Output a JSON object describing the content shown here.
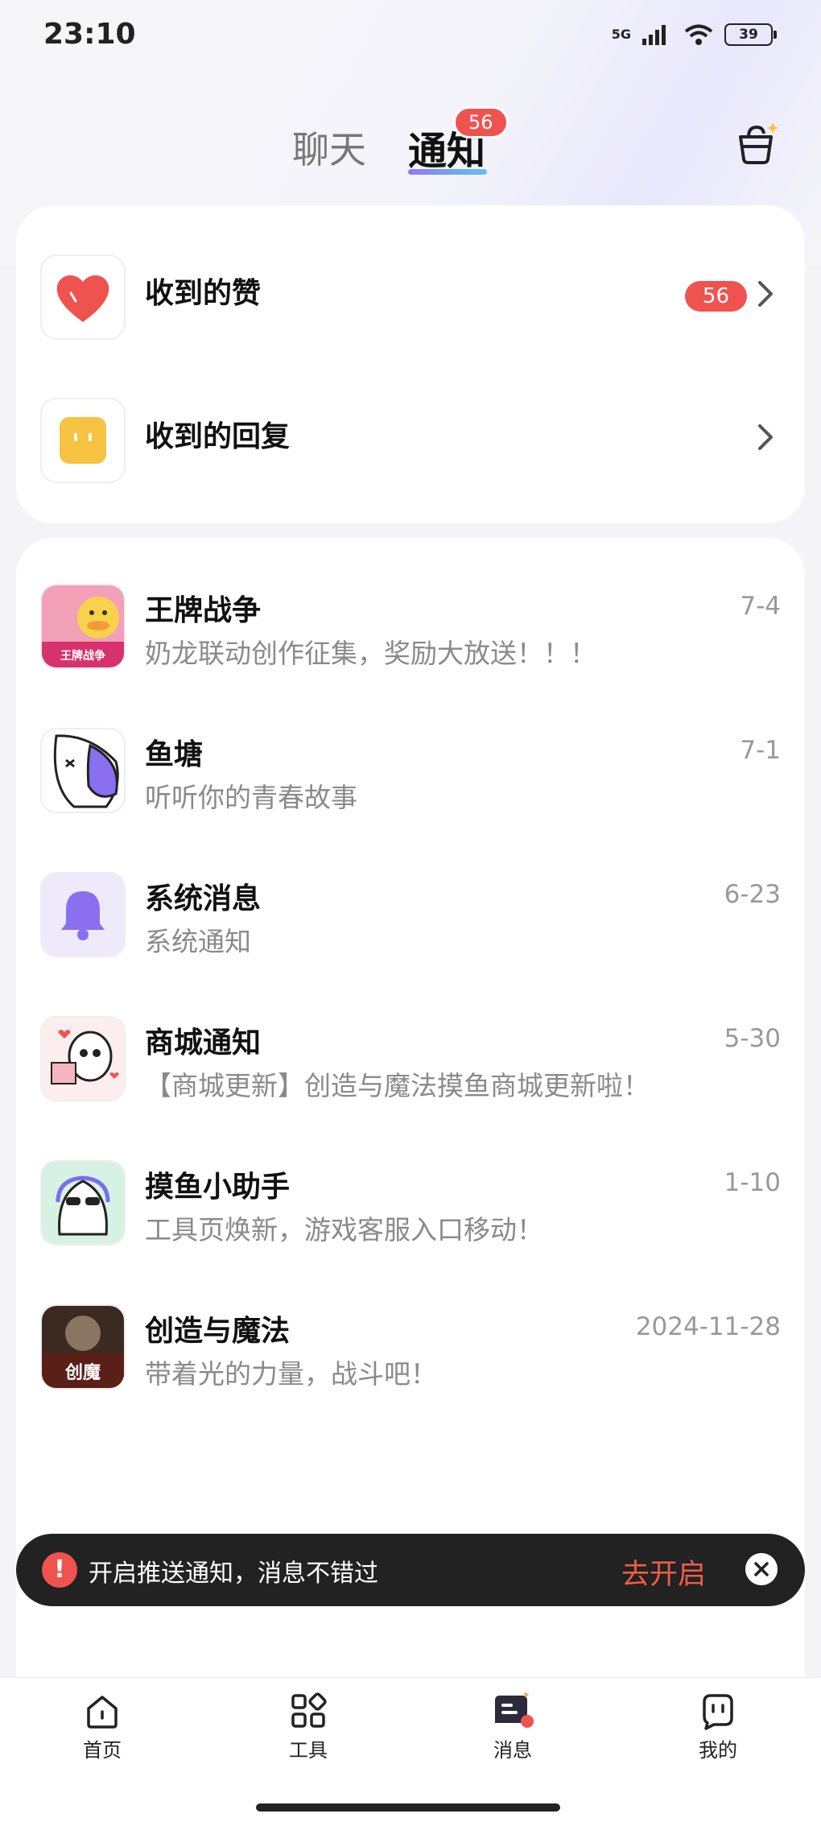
{
  "status_bar": {
    "time": "23:10",
    "network": "5G",
    "battery": "39"
  },
  "tabs": {
    "chat": "聊天",
    "notice": "通知",
    "notice_badge": "56"
  },
  "interactions": [
    {
      "label": "收到的赞",
      "badge": "56"
    },
    {
      "label": "收到的回复",
      "badge": ""
    }
  ],
  "notifications": [
    {
      "title": "王牌战争",
      "subtitle": "奶龙联动创作征集，奖励大放送！！！",
      "date": "7-4"
    },
    {
      "title": "鱼塘",
      "subtitle": "听听你的青春故事",
      "date": "7-1"
    },
    {
      "title": "系统消息",
      "subtitle": "系统通知",
      "date": "6-23"
    },
    {
      "title": "商城通知",
      "subtitle": "【商城更新】创造与魔法摸鱼商城更新啦！",
      "date": "5-30"
    },
    {
      "title": "摸鱼小助手",
      "subtitle": "工具页焕新，游戏客服入口移动！",
      "date": "1-10"
    },
    {
      "title": "创造与魔法",
      "subtitle": "带着光的力量，战斗吧！",
      "date": "2024-11-28"
    }
  ],
  "avatar_text": {
    "game1": "王牌战争",
    "game2": "创魔"
  },
  "toast": {
    "text": "开启推送通知，消息不错过",
    "action": "去开启"
  },
  "bottom_nav": [
    {
      "label": "首页",
      "icon": "home-icon"
    },
    {
      "label": "工具",
      "icon": "grid-icon"
    },
    {
      "label": "消息",
      "icon": "message-icon"
    },
    {
      "label": "我的",
      "icon": "profile-icon"
    }
  ],
  "colors": {
    "accent_red": "#ef5350",
    "tab_gradient_start": "#8d7bf2",
    "tab_gradient_end": "#5cc4f2"
  }
}
